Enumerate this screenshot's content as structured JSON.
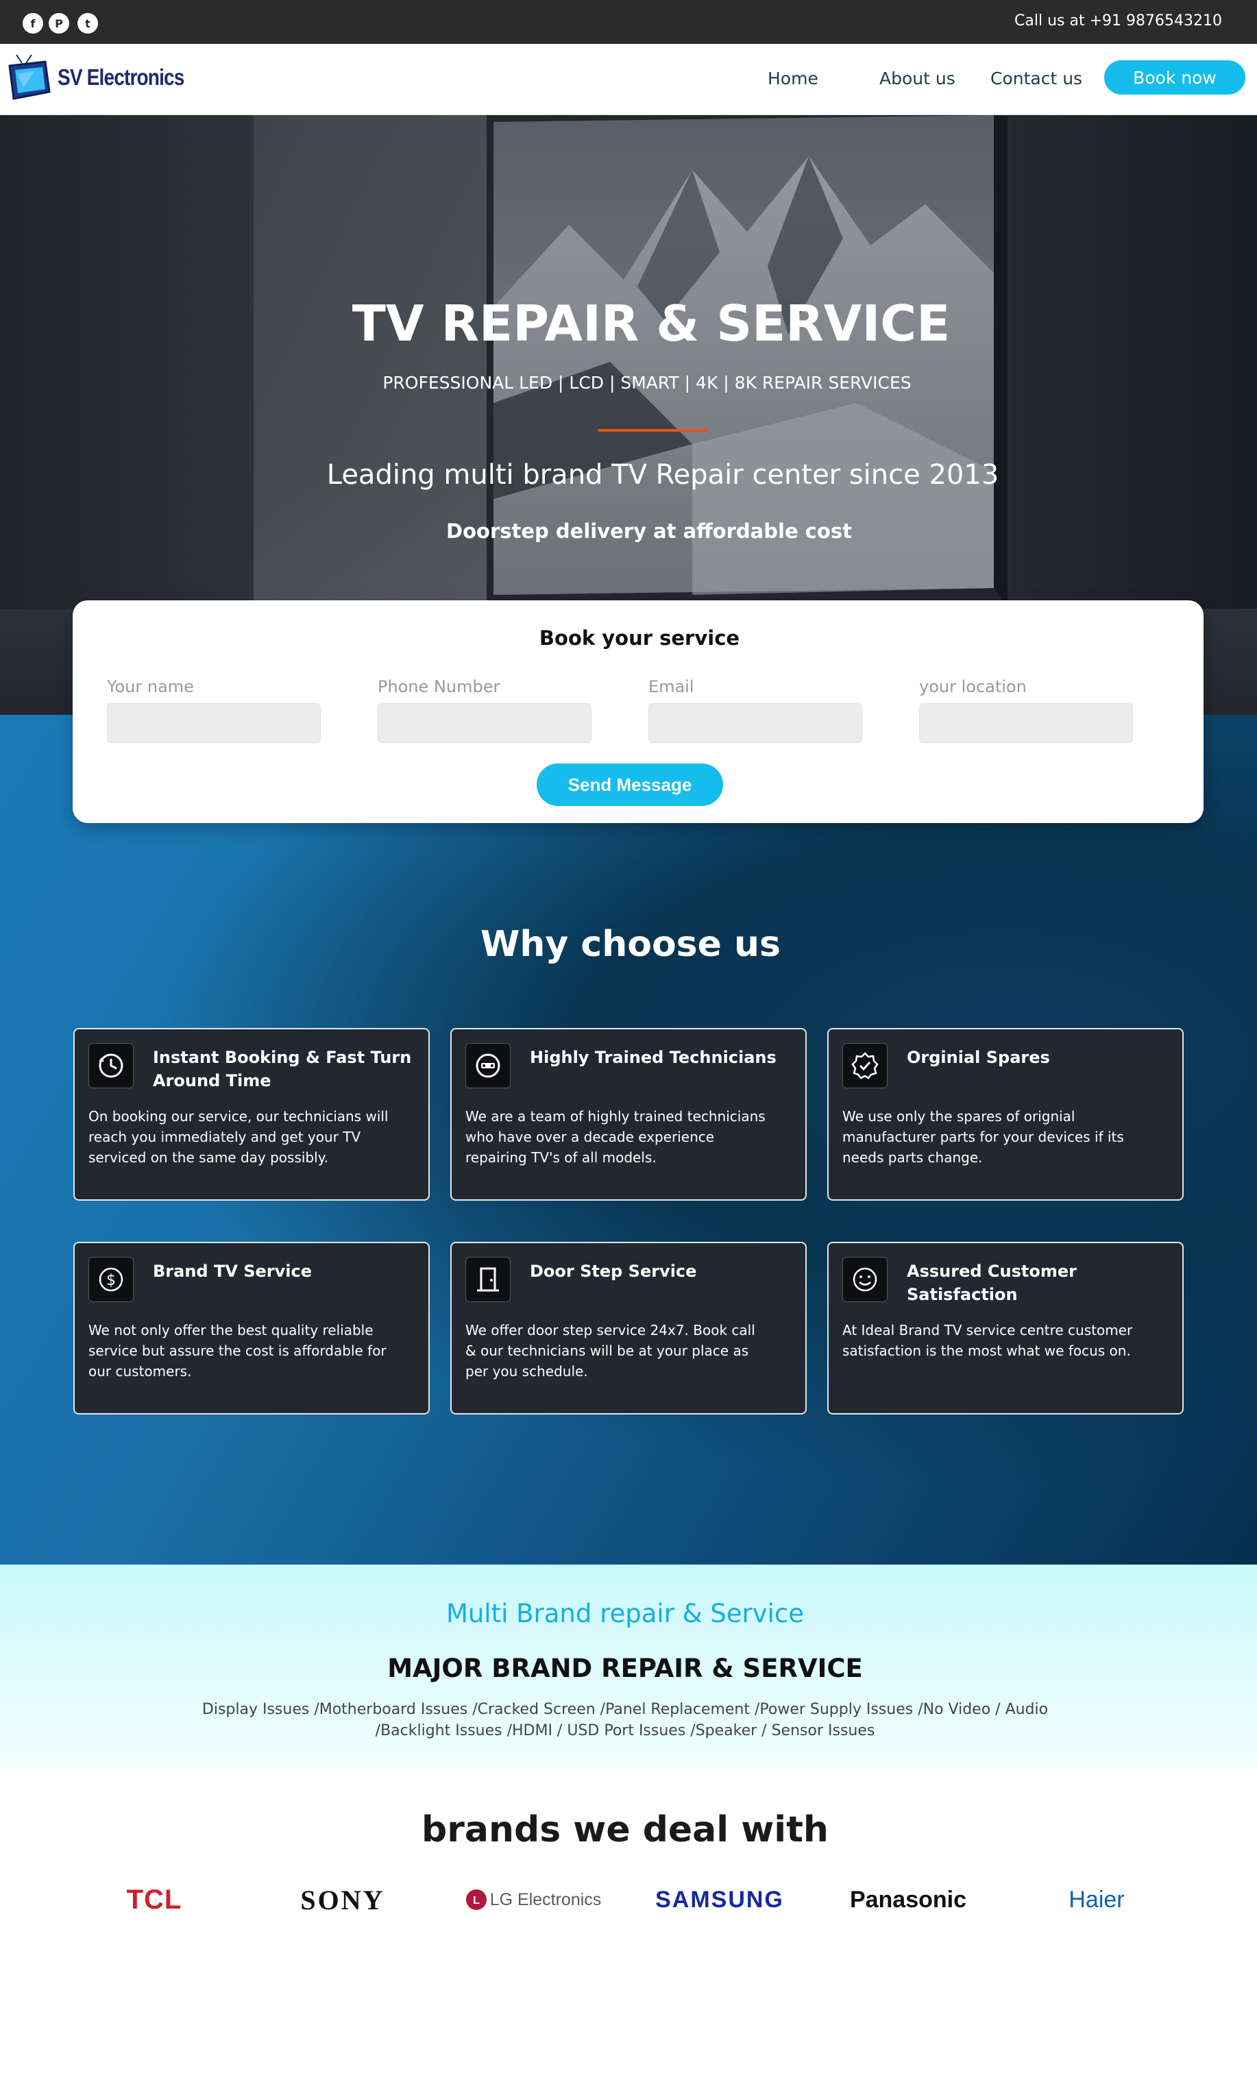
{
  "topbar": {
    "social": [
      {
        "name": "facebook-icon",
        "glyph": "f"
      },
      {
        "name": "pinterest-icon",
        "glyph": "P"
      },
      {
        "name": "twitter-icon",
        "glyph": "t"
      }
    ],
    "call": "Call us at +91 9876543210"
  },
  "nav": {
    "logo_text": "SV Electronics",
    "links": [
      "Home",
      "About us",
      "Contact us"
    ],
    "cta": "Book now"
  },
  "hero": {
    "title": "TV REPAIR & SERVICE",
    "subtitle": "PROFESSIONAL LED | LCD | SMART | 4K | 8K REPAIR SERVICES",
    "lead": "Leading multi brand TV Repair center since 2013",
    "tagline": "Doorstep delivery at affordable cost",
    "accent_color": "#e2561b"
  },
  "booking": {
    "title": "Book your service",
    "fields": [
      {
        "label": "Your name",
        "value": ""
      },
      {
        "label": "Phone Number",
        "value": ""
      },
      {
        "label": "Email",
        "value": ""
      },
      {
        "label": "your location",
        "value": ""
      }
    ],
    "submit": "Send Message",
    "button_color": "#14bdeb"
  },
  "why": {
    "title": "Why choose us",
    "cards": [
      {
        "icon": "clock-icon",
        "title": "Instant Booking & Fast Turn Around Time",
        "text": "On booking our service, our technicians will reach you immediately and get your TV serviced on the same day possibly."
      },
      {
        "icon": "technician-icon",
        "title": "Highly Trained Technicians",
        "text": "We are a team of highly trained technicians who have over a decade experience repairing TV's of all models."
      },
      {
        "icon": "badge-check-icon",
        "title": "Orginial Spares",
        "text": "We use only the spares of orignial manufacturer parts for your devices if its needs parts change."
      },
      {
        "icon": "dollar-icon",
        "title": "Brand TV Service",
        "text": "We not only offer the best quality reliable service but assure the cost is affordable for our customers."
      },
      {
        "icon": "door-icon",
        "title": "Door Step Service",
        "text": "We offer door step service 24x7. Book call & our technicians will be at your place as per you schedule."
      },
      {
        "icon": "smiley-icon",
        "title": "Assured Customer Satisfaction",
        "text": "At Ideal Brand TV service centre customer satisfaction is the most what we focus on."
      }
    ]
  },
  "multi": {
    "title": "Multi Brand repair & Service",
    "subtitle": "MAJOR BRAND REPAIR & SERVICE",
    "issues": "Display Issues /Motherboard Issues /Cracked Screen /Panel Replacement /Power Supply Issues /No Video / Audio /Backlight Issues /HDMI / USD Port Issues /Speaker / Sensor Issues"
  },
  "brands": {
    "title": "brands we deal with",
    "items": [
      {
        "name": "TCL",
        "color": "#d21e2b"
      },
      {
        "name": "SONY",
        "color": "#111111"
      },
      {
        "name": "LG Electronics",
        "color": "#5a5a5a"
      },
      {
        "name": "SAMSUNG",
        "color": "#1428a0"
      },
      {
        "name": "Panasonic",
        "color": "#111111"
      },
      {
        "name": "Haier",
        "color": "#0a5fb4"
      }
    ]
  }
}
